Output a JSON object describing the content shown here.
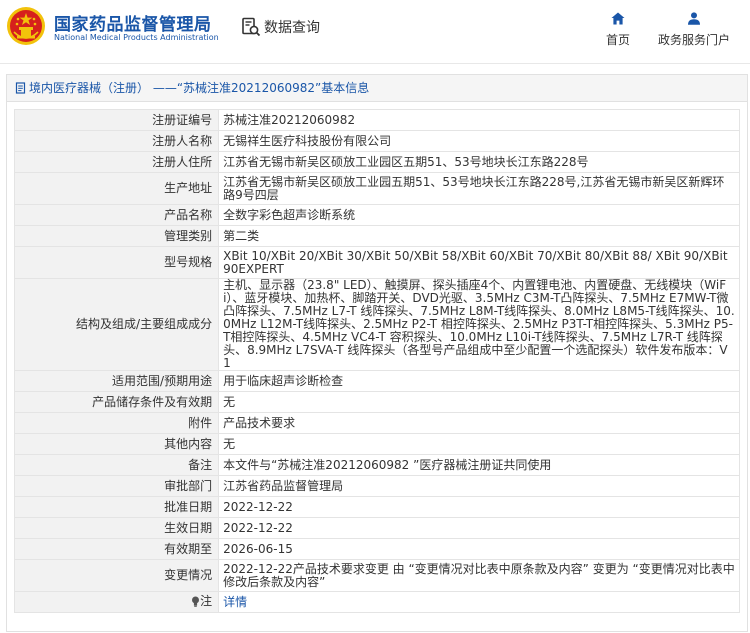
{
  "header": {
    "org_name_cn": "国家药品监督管理局",
    "org_name_en": "National Medical Products Administration",
    "search_label": "数据查询",
    "nav_home": "首页",
    "nav_gov": "政务服务门户"
  },
  "panel": {
    "title": "境内医疗器械（注册） ——“苏械注准20212060982”基本信息"
  },
  "rows": [
    {
      "label": "注册证编号",
      "value": "苏械注准20212060982"
    },
    {
      "label": "注册人名称",
      "value": "无锡祥生医疗科技股份有限公司"
    },
    {
      "label": "注册人住所",
      "value": "江苏省无锡市新吴区硕放工业园区五期51、53号地块长江东路228号"
    },
    {
      "label": "生产地址",
      "value": "江苏省无锡市新吴区硕放工业园五期51、53号地块长江东路228号,江苏省无锡市新吴区新辉环路9号四层"
    },
    {
      "label": "产品名称",
      "value": "全数字彩色超声诊断系统"
    },
    {
      "label": "管理类别",
      "value": "第二类"
    },
    {
      "label": "型号规格",
      "value": "XBit 10/XBit 20/XBit 30/XBit 50/XBit 58/XBit 60/XBit 70/XBit 80/XBit 88/ XBit 90/XBit 90EXPERT"
    },
    {
      "label": "结构及组成/主要组成成分",
      "value": "主机、显示器（23.8\" LED）、触摸屏、探头插座4个、内置锂电池、内置硬盘、无线模块（WiFi）、蓝牙模块、加热杯、脚踏开关、DVD光驱、3.5MHz C3M-T凸阵探头、7.5MHz E7MW-T微凸阵探头、7.5MHz L7-T 线阵探头、7.5MHz L8M-T线阵探头、8.0MHz L8M5-T线阵探头、10.0MHz L12M-T线阵探头、2.5MHz P2-T 相控阵探头、2.5MHz P3T-T相控阵探头、5.3MHz P5-T相控阵探头、4.5MHz VC4-T 容积探头、10.0MHz L10i-T线阵探头、7.5MHz L7R-T 线阵探头、8.9MHz L7SVA-T 线阵探头（各型号产品组成中至少配置一个选配探头）软件发布版本：V1"
    },
    {
      "label": "适用范围/预期用途",
      "value": "用于临床超声诊断检查"
    },
    {
      "label": "产品储存条件及有效期",
      "value": "无"
    },
    {
      "label": "附件",
      "value": "产品技术要求"
    },
    {
      "label": "其他内容",
      "value": "无"
    },
    {
      "label": "备注",
      "value": "本文件与“苏械注准20212060982 ”医疗器械注册证共同使用"
    },
    {
      "label": "审批部门",
      "value": "江苏省药品监督管理局"
    },
    {
      "label": "批准日期",
      "value": "2022-12-22"
    },
    {
      "label": "生效日期",
      "value": "2022-12-22"
    },
    {
      "label": "有效期至",
      "value": "2026-06-15"
    },
    {
      "label": "变更情况",
      "value": "2022-12-22产品技术要求变更 由 “变更情况对比表中原条款及内容” 变更为 “变更情况对比表中修改后条款及内容”"
    }
  ],
  "note": {
    "label": "注",
    "link": "详情",
    "icon": "lightbulb-icon"
  },
  "colors": {
    "brand_blue": "#1a56a8",
    "emblem_red": "#d6201c",
    "emblem_gold": "#f2c20b"
  }
}
